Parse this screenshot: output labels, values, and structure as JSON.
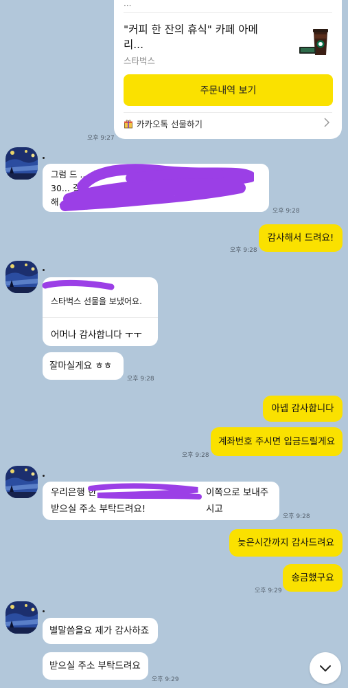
{
  "gift_card": {
    "top_partial": "...",
    "title": "\"커피 한 잔의 휴식\" 카페 아메리...",
    "brand": "스타벅스",
    "order_button_label": "주문내역 보기",
    "kakao_gift_link": "카카오톡 선물하기",
    "time": "오후 9:27"
  },
  "messages": [
    {
      "id": "m1",
      "sender": "other",
      "text": "그럼 ... 30... 해... 같아요",
      "lines": [
        "그럼 드 ... 송료",
        "30... 걸로",
        "해... 같아요"
      ],
      "time": "오후 9:28"
    },
    {
      "id": "m2",
      "sender": "me",
      "text": "감사해서 드려요!",
      "time": "오후 9:28"
    },
    {
      "id": "m3",
      "sender": "other",
      "gift_line": "스타벅스 선물을 보냈어요.",
      "text": "어머나 감사합니다 ㅜㅜ"
    },
    {
      "id": "m4",
      "sender": "other",
      "text": "잘마실게요 ㅎㅎ",
      "time": "오후 9:28"
    },
    {
      "id": "m5",
      "sender": "me",
      "text": "아녭 감사합니다"
    },
    {
      "id": "m6",
      "sender": "me",
      "text": "계좌번호 주시면 입금드릴게요",
      "time": "오후 9:28"
    },
    {
      "id": "m7",
      "sender": "other",
      "line1": "우리은행 한",
      "line1_tail": "이쪽으로 보내주시고",
      "line2": "받으실 주소 부탁드려요!",
      "time": "오후 9:28"
    },
    {
      "id": "m8",
      "sender": "me",
      "text": "늦은시간까지 감사드려요"
    },
    {
      "id": "m9",
      "sender": "me",
      "text": "송금했구요",
      "time": "오후 9:29"
    },
    {
      "id": "m10",
      "sender": "other",
      "text": "별말씀을요 제가 감사하죠"
    },
    {
      "id": "m11",
      "sender": "other",
      "text": "받으실 주소 부탁드려요",
      "time": "오후 9:29"
    }
  ],
  "colors": {
    "background": "#b2c7da",
    "my_bubble": "#fae100",
    "other_bubble": "#ffffff",
    "redaction": "#9b3fe6"
  },
  "icons": {
    "scroll_down": "chevron-down-icon",
    "gift": "gift-box-icon",
    "chevron": "chevron-right-icon"
  }
}
